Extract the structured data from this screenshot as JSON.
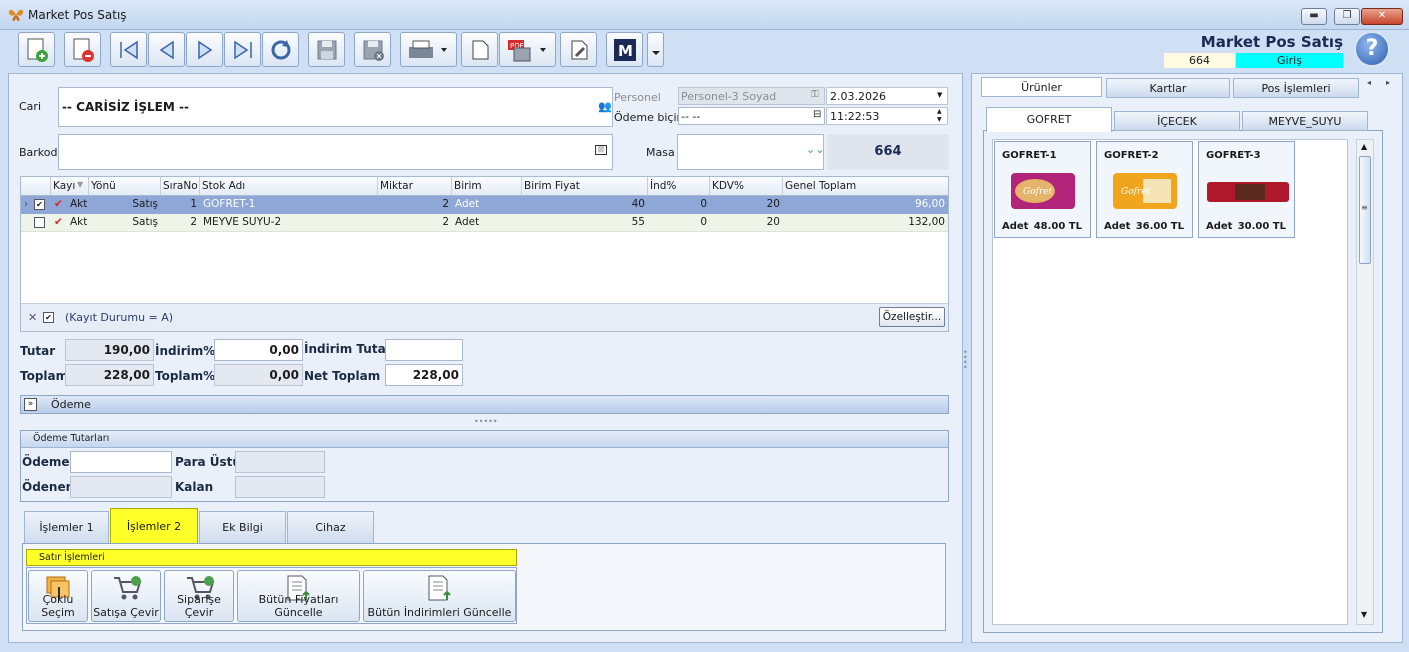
{
  "window": {
    "title": "Market Pos Satış",
    "minimize": "▬",
    "maximize": "❐",
    "close": "✕"
  },
  "header": {
    "app_title": "Market Pos Satış",
    "code": "664",
    "status": "Giriş"
  },
  "form": {
    "cari_label": "Cari",
    "cari_value": "-- CARİSİZ İŞLEM --",
    "barkod_label": "Barkod",
    "barkod_value": "",
    "personel_label": "Personel",
    "personel_value": "Personel-3 Soyad",
    "odeme_label": "Ödeme biçimi",
    "odeme_value": "-- --",
    "date": "2.03.2026",
    "time": "11:22:53",
    "masa_label": "Masa",
    "masa_value": "",
    "masa_no": "664"
  },
  "grid": {
    "columns": [
      "Kayı",
      "Yönü",
      "SıraNo",
      "Stok Adı",
      "Miktar",
      "Birim",
      "Birim Fiyat",
      "İnd%",
      "KDV%",
      "Genel Toplam"
    ],
    "rows": [
      {
        "kayit": "Akt",
        "yonu": "Satış",
        "sira": "1",
        "stok": "GOFRET-1",
        "miktar": "2",
        "birim": "Adet",
        "fiyat": "40",
        "ind": "0",
        "kdv": "20",
        "toplam": "96,00"
      },
      {
        "kayit": "Akt",
        "yonu": "Satış",
        "sira": "2",
        "stok": "MEYVE SUYU-2",
        "miktar": "2",
        "birim": "Adet",
        "fiyat": "55",
        "ind": "0",
        "kdv": "20",
        "toplam": "132,00"
      }
    ],
    "filter_text": "(Kayıt Durumu = A)",
    "customize_button": "Özelleştir..."
  },
  "totals": {
    "tutar_label": "Tutar",
    "tutar": "190,00",
    "indirim_pct_label": "İndirim%",
    "indirim_pct": "0,00",
    "indirim_tutar_label": "İndirim Tutar",
    "indirim_tutar": "",
    "toplam_label": "Toplam",
    "toplam": "228,00",
    "toplam_pct_label": "Toplam%",
    "toplam_pct": "0,00",
    "net_label": "Net Toplam",
    "net": "228,00"
  },
  "odeme_bar": {
    "label": "Ödeme"
  },
  "odeme_tutarlari": {
    "title": "Ödeme Tutarları",
    "odeme_label": "Ödeme",
    "odeme": "",
    "para_ustu_label": "Para Üstü",
    "para_ustu": "",
    "odenen_label": "Ödenen",
    "odenen": "",
    "kalan_label": "Kalan",
    "kalan": ""
  },
  "bottom_tabs": [
    "İşlemler 1",
    "İşlemler 2",
    "Ek Bilgi",
    "Cihaz"
  ],
  "satir_islemleri": {
    "title": "Satır İşlemleri",
    "buttons": [
      "Çoklu Seçim",
      "Satışa Çevir",
      "Siparişe Çevir",
      "Bütün Fiyatları Güncelle",
      "Bütün İndirimleri Güncelle"
    ]
  },
  "right": {
    "tabs": [
      "Ürünler",
      "Kartlar",
      "Pos İşlemleri"
    ],
    "category_tabs": [
      "GOFRET",
      "İÇECEK",
      "MEYVE_SUYU"
    ],
    "products": [
      {
        "name": "GOFRET-1",
        "unit": "Adet",
        "price": "48.00 TL"
      },
      {
        "name": "GOFRET-2",
        "unit": "Adet",
        "price": "36.00 TL"
      },
      {
        "name": "GOFRET-3",
        "unit": "Adet",
        "price": "30.00 TL"
      }
    ]
  }
}
